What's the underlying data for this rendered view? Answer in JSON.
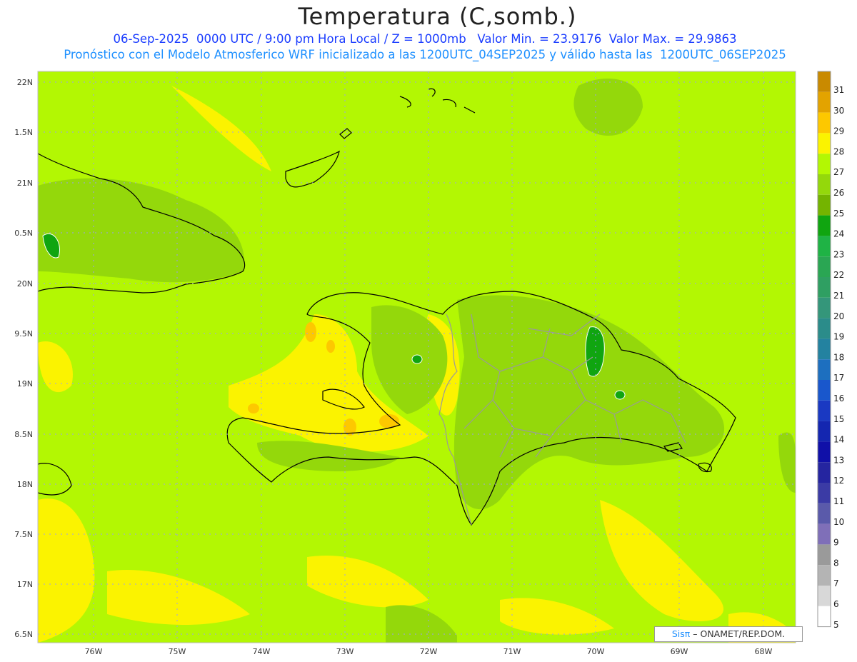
{
  "title": "Temperatura (C,somb.)",
  "subtitle_line1": "06-Sep-2025  0000 UTC / 9:00 pm Hora Local / Z = 1000mb   Valor Min. = 23.9176  Valor Max. = 29.9863",
  "subtitle_line2": "Pronóstico con el Modelo Atmosferico WRF inicializado a las 1200UTC_04SEP2025 y válido hasta las  1200UTC_06SEP2025",
  "credit": {
    "brand": "Sisπ",
    "text": " – ONAMET/REP.DOM."
  },
  "map": {
    "lat_labels": [
      "22N",
      "1.5N",
      "21N",
      "0.5N",
      "20N",
      "9.5N",
      "19N",
      "8.5N",
      "18N",
      "7.5N",
      "17N",
      "6.5N"
    ],
    "lon_labels": [
      "76W",
      "75W",
      "74W",
      "73W",
      "72W",
      "71W",
      "70W",
      "69W",
      "68W"
    ],
    "background_color": "#b3f703"
  },
  "colorbar": {
    "labels": [
      "31",
      "30",
      "29",
      "28",
      "27",
      "26",
      "25",
      "24",
      "23",
      "22",
      "21",
      "20",
      "19",
      "18",
      "17",
      "16",
      "15",
      "14",
      "13",
      "12",
      "11",
      "10",
      "9",
      "8",
      "7",
      "6",
      "5"
    ],
    "colors": [
      "#c98a00",
      "#e3a300",
      "#fdc800",
      "#fbf300",
      "#b3f703",
      "#94d80b",
      "#74b400",
      "#10a510",
      "#1fb345",
      "#2aa653",
      "#2f9f62",
      "#34967a",
      "#2b8c8a",
      "#2382a0",
      "#1d6fbf",
      "#1957cc",
      "#1a39c2",
      "#1426b0",
      "#1010a8",
      "#2525a0",
      "#3b3ba5",
      "#5a5aaa",
      "#7f6fb8",
      "#9a9a9a",
      "#b4b4b4",
      "#d8d8d8",
      "#ffffff"
    ]
  }
}
